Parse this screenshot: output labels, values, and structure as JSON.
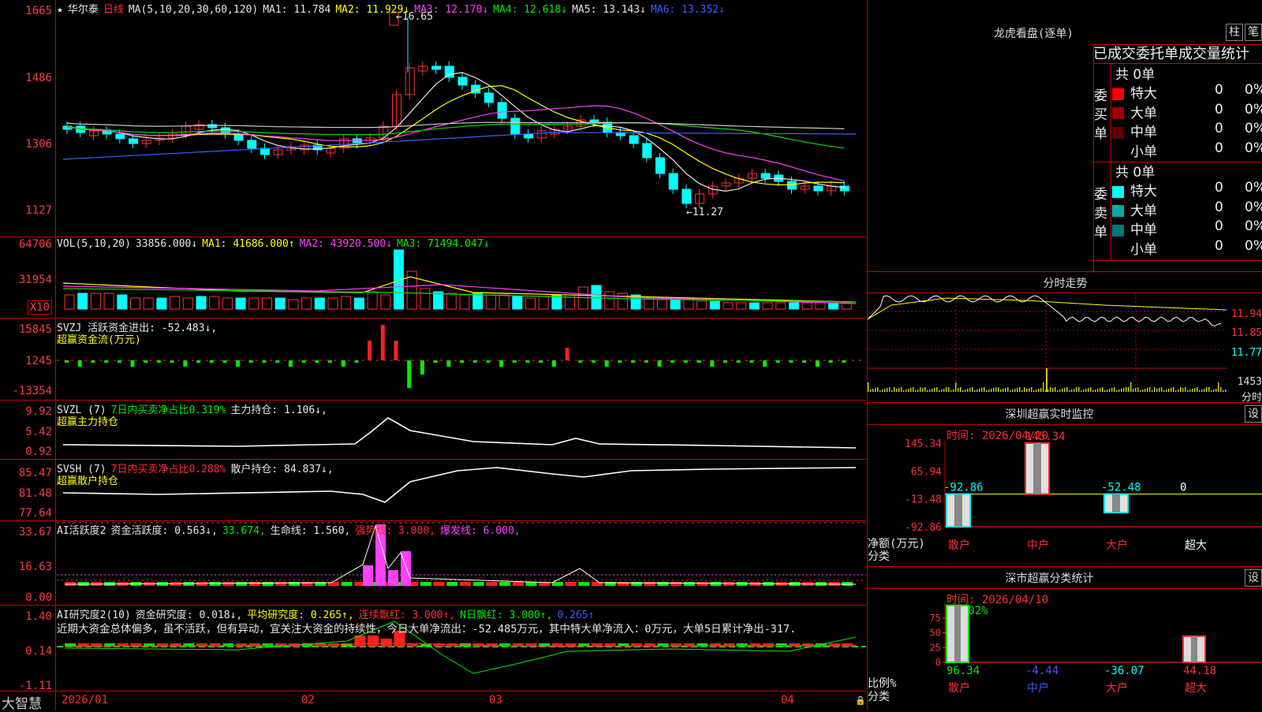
{
  "stock": {
    "name": "华尔泰",
    "period": "日线"
  },
  "main_panel": {
    "y_ticks": [
      "1665",
      "1486",
      "1306",
      "1127"
    ],
    "ma_header": {
      "label": "MA(5,10,20,30,60,120)",
      "ma1": "MA1: 11.784",
      "ma2": "MA2: 11.929↓",
      "ma3": "MA3: 12.170↓",
      "ma4": "MA4: 12.618↓",
      "ma5": "MA5: 13.143↓",
      "ma6": "MA6: 13.352↓"
    },
    "high_label": "16.65",
    "low_label": "11.27"
  },
  "vol_panel": {
    "y_ticks": [
      "64706",
      "31954"
    ],
    "unit": "X10",
    "header": {
      "label": "VOL(5,10,20)",
      "vol": "33856.000↓",
      "ma1": "MA1: 41686.000↑",
      "ma2": "MA2: 43920.500↓",
      "ma3": "MA3: 71494.047↓"
    }
  },
  "svzj_panel": {
    "y_ticks": [
      "15845",
      "1245",
      "-13354"
    ],
    "header": "SVZJ  活跃资金进出: -52.483↓,",
    "subtitle": "超赢资金流(万元)"
  },
  "svzl_panel": {
    "y_ticks": [
      "9.92",
      "5.42",
      "0.92"
    ],
    "header_a": "SVZL  (7)",
    "header_b": "7日内买卖净占比0.319%",
    "header_c": "主力持仓: 1.106↓,",
    "subtitle": "超赢主力持仓"
  },
  "svsh_panel": {
    "y_ticks": [
      "85.47",
      "81.48",
      "77.64"
    ],
    "header_a": "SVSH  (7)",
    "header_b": "7日内买卖净占比0.288%",
    "header_c": "散户持仓: 84.837↓,",
    "subtitle": "超赢散户持仓"
  },
  "ai_active_panel": {
    "y_ticks": [
      "33.67",
      "16.63",
      "0.00"
    ],
    "h1": "AI活跃度2",
    "h2": "资金活跃度: 0.563↓,",
    "h3": "33.674,",
    "h4": "生命线: 1.560,",
    "h5": "强势线: 3.000,",
    "h6": "爆发线: 6.000,"
  },
  "ai_research_panel": {
    "y_ticks": [
      "1.40",
      "0.14",
      "-1.11"
    ],
    "h1": "AI研究度2(10)",
    "h2": "资金研究度: 0.018↓,",
    "h3": "平均研究度: 0.265↑,",
    "h4": "连续飘红: 3.000↑,",
    "h5": "N日飘红: 3.000↑,",
    "h6": "0.265↑",
    "commentary": "近期大资金总体偏多，虽不活跃，但有异动，宜关注大资金的持续性，今日大单净流出：-52.485万元，其中特大单净流入：0万元，大单5日累计净出-317."
  },
  "time_axis": {
    "brand": "大智慧",
    "labels": [
      "2026/01",
      "02",
      "03",
      "04"
    ]
  },
  "dragon_tiger": {
    "title": "龙虎看盘(逐单)",
    "btn1": "柱",
    "btn2": "笔",
    "subtitle": "已成交委托单成交量统计",
    "buy": {
      "side": "委买单",
      "total": "共 0单",
      "rows": [
        {
          "label": "特大",
          "count": "0",
          "pct": "0%",
          "color": "#ff0000"
        },
        {
          "label": "大单",
          "count": "0",
          "pct": "0%",
          "color": "#a00000"
        },
        {
          "label": "中单",
          "count": "0",
          "pct": "0%",
          "color": "#600000"
        },
        {
          "label": "小单",
          "count": "0",
          "pct": "0%",
          "color": ""
        }
      ]
    },
    "sell": {
      "side": "委卖单",
      "total": "共 0单",
      "rows": [
        {
          "label": "特大",
          "count": "0",
          "pct": "0%",
          "color": "#00ffff"
        },
        {
          "label": "大单",
          "count": "0",
          "pct": "0%",
          "color": "#00aaaa"
        },
        {
          "label": "中单",
          "count": "0",
          "pct": "0%",
          "color": "#007777"
        },
        {
          "label": "小单",
          "count": "0",
          "pct": "0%",
          "color": ""
        }
      ]
    }
  },
  "intraday": {
    "title": "分时走势",
    "prices": [
      "11.94",
      "11.85",
      "11.77"
    ],
    "vol": "1453",
    "vol_unit": "分时"
  },
  "sz_monitor": {
    "title": "深圳超赢实时监控",
    "btn": "设",
    "time": "时间: 2026/04/10",
    "y_ticks": [
      "145.34",
      "65.94",
      "-13.48",
      "-92.86"
    ],
    "ylabel1": "净额(万元)",
    "ylabel2": "分类",
    "chart_data": {
      "type": "bar",
      "categories": [
        "散户",
        "中户",
        "大户",
        "超大"
      ],
      "values": [
        -92.86,
        145.34,
        -52.48,
        0
      ],
      "value_labels": [
        "-92.86",
        "145.34",
        "-52.48",
        "0"
      ],
      "ylim": [
        -92.86,
        145.34
      ]
    }
  },
  "sz_class": {
    "title": "深市超赢分类统计",
    "btn": "设",
    "time": "时间: 2026/04/10",
    "top_label": "-0.02%",
    "y_ticks": [
      "75",
      "50",
      "25",
      "0"
    ],
    "ylabel1": "比例%",
    "ylabel2": "分类",
    "chart_data": {
      "type": "bar",
      "categories": [
        "散户",
        "中户",
        "大户",
        "超大"
      ],
      "values": [
        96.34,
        -4.44,
        -36.07,
        44.18
      ],
      "value_labels": [
        "96.34",
        "-4.44",
        "-36.07",
        "44.18"
      ],
      "ylim": [
        0,
        100
      ]
    }
  }
}
